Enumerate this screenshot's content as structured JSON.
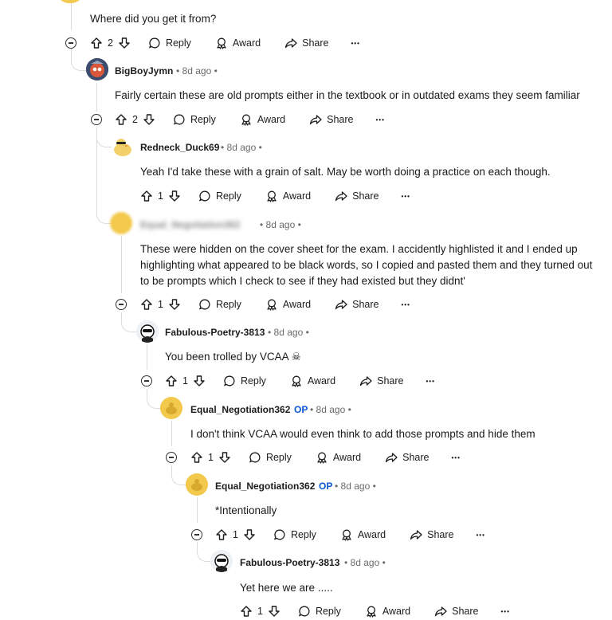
{
  "comments": [
    {
      "id": "c0",
      "username": "",
      "time": "",
      "text": "Where did you get it from?",
      "votes": "2"
    },
    {
      "id": "c1",
      "username": "BigBoyJymn",
      "time": "8d ago",
      "text": "Fairly certain these are old prompts either in the textbook or in outdated exams they seem familiar",
      "votes": "2"
    },
    {
      "id": "c2",
      "username": "Redneck_Duck69",
      "time": "8d ago",
      "text": "Yeah I'd take these with a grain of salt. May be worth doing a practice on each though.",
      "votes": "1"
    },
    {
      "id": "c3",
      "username": "Equal_Negotiation362",
      "time": "8d ago",
      "text": "These were hidden on the cover sheet for the exam. I accidently highlisted it and I ended up highlighting what appeared to be black words, so I copied and pasted them and they turned out to be prompts which I check to see if they had existed but they didnt'",
      "votes": "1"
    },
    {
      "id": "c4",
      "username": "Fabulous-Poetry-3813",
      "time": "8d ago",
      "text": "You been trolled by VCAA ☠",
      "votes": "1"
    },
    {
      "id": "c5",
      "username": "Equal_Negotiation362",
      "op": "OP",
      "time": "8d ago",
      "text": "I don't think VCAA would even think to add those prompts and hide them",
      "votes": "1"
    },
    {
      "id": "c6",
      "username": "Equal_Negotiation362",
      "op": "OP",
      "time": "8d ago",
      "text": "*Intentionally",
      "votes": "1"
    },
    {
      "id": "c7",
      "username": "Fabulous-Poetry-3813",
      "time": "8d ago",
      "text": "Yet here we are .....",
      "votes": "1"
    }
  ],
  "labels": {
    "reply": "Reply",
    "award": "Award",
    "share": "Share",
    "more": "•••",
    "dot": "•"
  },
  "colors": {
    "op": "#0a58d0",
    "thread_line": "#d9dde0",
    "meta": "#6b6b6b"
  }
}
